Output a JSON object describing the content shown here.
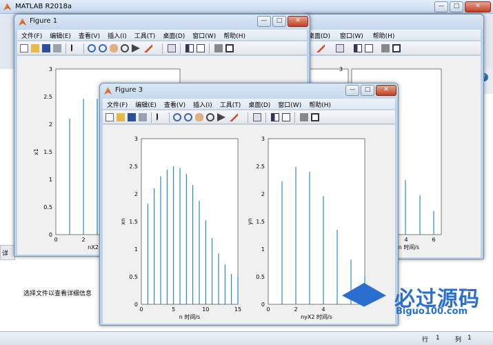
{
  "matlab": {
    "title": "MATLAB R2018a",
    "status_row_label": "行",
    "status_row_value": "1",
    "status_col_label": "列",
    "status_col_value": "1",
    "details_text": "选择文件以查看详细信息",
    "left_cut_letter": "详"
  },
  "menus": [
    "文件(F)",
    "编辑(E)",
    "查看(V)",
    "插入(I)",
    "工具(T)",
    "桌面(D)",
    "窗口(W)",
    "帮助(H)"
  ],
  "figure1": {
    "title": "Figure 1",
    "ylabel": "x1",
    "xlabel": "nX2",
    "yticks": [
      "0",
      "0.5",
      "1",
      "1.5",
      "2",
      "2.5",
      "3"
    ],
    "xticks": [
      "0",
      "2"
    ]
  },
  "figure2_visible": {
    "y_top": "3",
    "xlabel": "n 时间/s",
    "xticks": [
      "4",
      "6"
    ],
    "y_top2": "3"
  },
  "figure3": {
    "title": "Figure 3",
    "left": {
      "ylabel": "xn",
      "xlabel": "n 时间/s",
      "yticks": [
        "0",
        "0.5",
        "1",
        "1.5",
        "2",
        "2.5",
        "3"
      ],
      "xticks": [
        "0",
        "5",
        "10",
        "15"
      ]
    },
    "right": {
      "ylabel": "yn",
      "xlabel": "nyX2 时间/s",
      "yticks": [
        "0",
        "0.5",
        "1",
        "1.5",
        "2",
        "2.5",
        "3"
      ],
      "xticks": [
        "0",
        "2",
        "4"
      ]
    }
  },
  "chart_data": [
    {
      "type": "scatter",
      "title": "",
      "xlabel": "n 时间/s",
      "ylabel": "xn",
      "xlim": [
        0,
        15
      ],
      "ylim": [
        0,
        3
      ],
      "x": [
        0,
        1,
        2,
        3,
        4,
        5,
        6,
        7,
        8,
        9,
        10,
        11,
        12,
        13,
        14,
        15
      ],
      "y": [
        0,
        1.82,
        2.1,
        2.32,
        2.44,
        2.5,
        2.47,
        2.36,
        2.16,
        1.88,
        1.52,
        1.2,
        0.92,
        0.72,
        0.55,
        0.5
      ]
    },
    {
      "type": "scatter",
      "title": "",
      "xlabel": "nyX2 时间/s",
      "ylabel": "yn",
      "xlim": [
        0,
        7
      ],
      "ylim": [
        0,
        3
      ],
      "x": [
        0,
        1,
        2,
        3,
        4,
        5,
        6,
        7
      ],
      "y": [
        0,
        2.23,
        2.49,
        2.4,
        1.96,
        1.35,
        0.81,
        0.5
      ]
    },
    {
      "type": "scatter",
      "title": "",
      "xlabel": "nX2",
      "ylabel": "x1",
      "xlim": [
        0,
        7
      ],
      "ylim": [
        0,
        3
      ],
      "x": [
        0,
        1,
        2,
        3
      ],
      "y": [
        0,
        2.1,
        2.46,
        2.46
      ]
    }
  ],
  "brand": {
    "name": "必过源码",
    "url": "Biguo100.com"
  }
}
